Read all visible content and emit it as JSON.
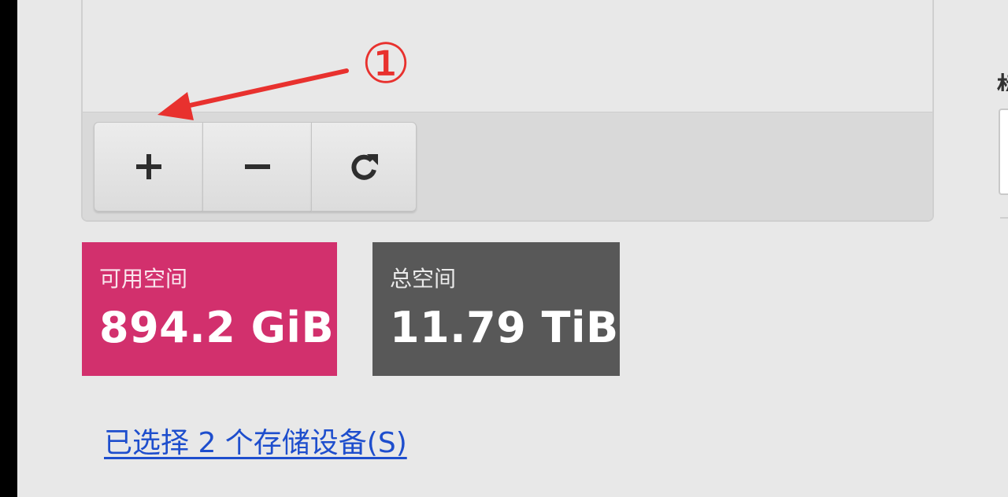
{
  "toolbar": {
    "add_label": "+",
    "remove_label": "−",
    "refresh_icon": "refresh-icon"
  },
  "space": {
    "available_label": "可用空间",
    "available_value": "894.2 GiB",
    "available_color": "#d2306d",
    "total_label": "总空间",
    "total_value": "11.79 TiB",
    "total_color": "#585858"
  },
  "devices_link": "已选择 2 个存储设备(S)",
  "annotation": {
    "number": "①",
    "color": "#e8312e"
  }
}
